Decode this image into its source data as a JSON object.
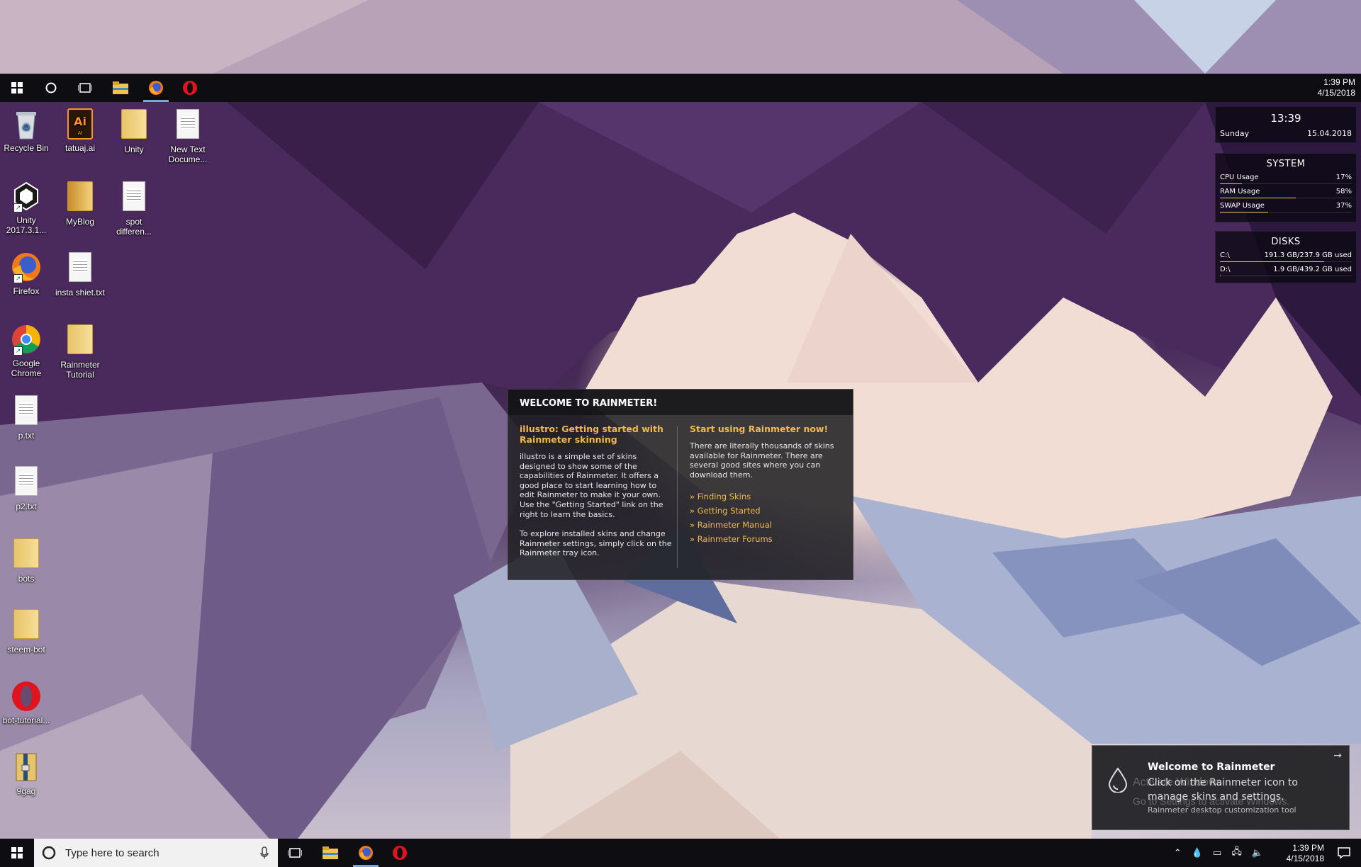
{
  "colors": {
    "accent": "#f2b94c",
    "taskbar": "#0e0e12",
    "ram_bar": "#ffc45a"
  },
  "top_taskbar": {
    "icons": [
      "windows-start-icon",
      "cortana-icon",
      "task-view-icon",
      "file-explorer-icon",
      "firefox-icon",
      "opera-icon"
    ],
    "time": "1:39 PM",
    "date": "4/15/2018"
  },
  "desktop_icons": [
    {
      "label": "Recycle Bin",
      "icon": "recycle-bin-icon"
    },
    {
      "label": "tatuaj.ai",
      "icon": "illustrator-file-icon"
    },
    {
      "label": "Unity",
      "icon": "folder-icon"
    },
    {
      "label": "New Text Docume...",
      "icon": "text-file-icon"
    },
    {
      "label": "Unity 2017.3.1...",
      "icon": "unity-icon"
    },
    {
      "label": "MyBlog",
      "icon": "folder-icon"
    },
    {
      "label": "spot differen...",
      "icon": "text-file-icon"
    },
    {
      "label": "Firefox",
      "icon": "firefox-icon"
    },
    {
      "label": "insta shiet.txt",
      "icon": "text-file-icon"
    },
    {
      "label": "Google Chrome",
      "icon": "chrome-icon"
    },
    {
      "label": "Rainmeter Tutorial",
      "icon": "folder-icon"
    },
    {
      "label": "p.txt",
      "icon": "text-file-icon"
    },
    {
      "label": "p2.txt",
      "icon": "text-file-icon"
    },
    {
      "label": "bots",
      "icon": "folder-icon"
    },
    {
      "label": "steem-bot",
      "icon": "folder-icon"
    },
    {
      "label": "bot-tutorial...",
      "icon": "opera-icon"
    },
    {
      "label": "9gag",
      "icon": "archive-icon"
    }
  ],
  "clock_skin": {
    "time": "13:39",
    "day": "Sunday",
    "date": "15.04.2018"
  },
  "system_skin": {
    "title": "SYSTEM",
    "rows": [
      {
        "label": "CPU Usage",
        "value": "17%",
        "fraction": 0.17
      },
      {
        "label": "RAM Usage",
        "value": "58%",
        "fraction": 0.58
      },
      {
        "label": "SWAP Usage",
        "value": "37%",
        "fraction": 0.37
      }
    ]
  },
  "disks_skin": {
    "title": "DISKS",
    "rows": [
      {
        "label": "C:\\",
        "value": "191.3 GB/237.9 GB used",
        "fraction": 0.8
      },
      {
        "label": "D:\\",
        "value": "1.9 GB/439.2 GB used",
        "fraction": 0.004
      }
    ]
  },
  "welcome": {
    "title": "WELCOME TO RAINMETER!",
    "left_heading": "illustro: Getting started with Rainmeter skinning",
    "left_p1": "illustro is a simple set of skins designed to show some of the capabilities of Rainmeter. It offers a good place to start learning how to edit Rainmeter to make it your own. Use the \"Getting Started\" link on the right to learn the basics.",
    "left_p2": "To explore installed skins and change Rainmeter settings, simply click on the Rainmeter tray icon.",
    "right_heading": "Start using Rainmeter now!",
    "right_p1": "There are literally thousands of skins available for Rainmeter. There are several good sites where you can download them.",
    "links": [
      "» Finding Skins",
      "» Getting Started",
      "» Rainmeter Manual",
      "» Rainmeter Forums"
    ]
  },
  "toast": {
    "title": "Welcome to Rainmeter",
    "body": "Click on the Rainmeter icon to manage skins and settings.",
    "subtitle": "Rainmeter desktop customization tool",
    "ghost_line1": "Activate Windows",
    "ghost_line2": "Go to Settings to activate Windows."
  },
  "taskbar": {
    "search_placeholder": "Type here to search",
    "time": "1:39 PM",
    "date": "4/15/2018",
    "tray_icons": [
      "chevron-up-icon",
      "rainmeter-tray-icon",
      "battery-icon",
      "network-icon",
      "volume-icon"
    ]
  }
}
